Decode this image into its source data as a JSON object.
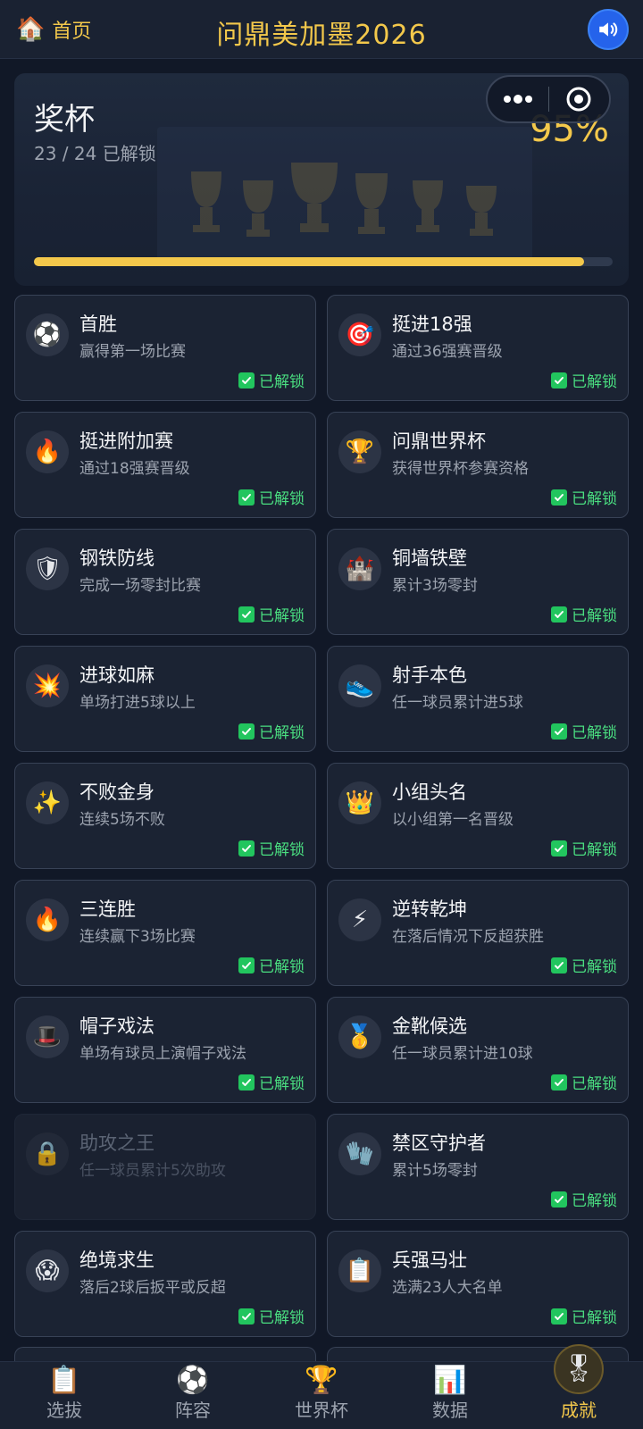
{
  "header": {
    "home_icon": "house-icon",
    "home_label": "首页",
    "title": "问鼎美加墨2026",
    "sound_icon": "speaker-icon"
  },
  "hero": {
    "title": "奖杯",
    "progress_text": "23 / 24 已解锁",
    "percent_text": "95%",
    "progress_fraction": 0.95,
    "capsule": {
      "more_icon": "more-dots-icon",
      "close_icon": "target-icon"
    }
  },
  "colors": {
    "accent": "#f3c84b",
    "unlocked": "#4ade80",
    "background": "#111827",
    "card": "#1b2333"
  },
  "achievements": [
    {
      "icon": "⚽",
      "icon_name": "soccer-ball-icon",
      "title": "首胜",
      "desc": "赢得第一场比赛",
      "status": "已解锁",
      "locked": false
    },
    {
      "icon": "🎯",
      "icon_name": "target-icon",
      "title": "挺进18强",
      "desc": "通过36强赛晋级",
      "status": "已解锁",
      "locked": false
    },
    {
      "icon": "🔥",
      "icon_name": "fire-icon",
      "title": "挺进附加赛",
      "desc": "通过18强赛晋级",
      "status": "已解锁",
      "locked": false
    },
    {
      "icon": "🏆",
      "icon_name": "trophy-icon",
      "title": "问鼎世界杯",
      "desc": "获得世界杯参赛资格",
      "status": "已解锁",
      "locked": false
    },
    {
      "icon": "🛡",
      "icon_name": "shield-icon",
      "title": "钢铁防线",
      "desc": "完成一场零封比赛",
      "status": "已解锁",
      "locked": false
    },
    {
      "icon": "🏰",
      "icon_name": "castle-icon",
      "title": "铜墙铁壁",
      "desc": "累计3场零封",
      "status": "已解锁",
      "locked": false
    },
    {
      "icon": "💥",
      "icon_name": "explosion-icon",
      "title": "进球如麻",
      "desc": "单场打进5球以上",
      "status": "已解锁",
      "locked": false
    },
    {
      "icon": "👟",
      "icon_name": "sneaker-icon",
      "title": "射手本色",
      "desc": "任一球员累计进5球",
      "status": "已解锁",
      "locked": false
    },
    {
      "icon": "✨",
      "icon_name": "sparkles-icon",
      "title": "不败金身",
      "desc": "连续5场不败",
      "status": "已解锁",
      "locked": false
    },
    {
      "icon": "👑",
      "icon_name": "crown-icon",
      "title": "小组头名",
      "desc": "以小组第一名晋级",
      "status": "已解锁",
      "locked": false
    },
    {
      "icon": "🔥",
      "icon_name": "fire-icon",
      "title": "三连胜",
      "desc": "连续赢下3场比赛",
      "status": "已解锁",
      "locked": false
    },
    {
      "icon": "⚡",
      "icon_name": "lightning-icon",
      "title": "逆转乾坤",
      "desc": "在落后情况下反超获胜",
      "status": "已解锁",
      "locked": false
    },
    {
      "icon": "🎩",
      "icon_name": "top-hat-icon",
      "title": "帽子戏法",
      "desc": "单场有球员上演帽子戏法",
      "status": "已解锁",
      "locked": false
    },
    {
      "icon": "🥇",
      "icon_name": "medal-icon",
      "title": "金靴候选",
      "desc": "任一球员累计进10球",
      "status": "已解锁",
      "locked": false
    },
    {
      "icon": "🔒",
      "icon_name": "lock-icon",
      "title": "助攻之王",
      "desc": "任一球员累计5次助攻",
      "status": "",
      "locked": true
    },
    {
      "icon": "🧤",
      "icon_name": "gloves-icon",
      "title": "禁区守护者",
      "desc": "累计5场零封",
      "status": "已解锁",
      "locked": false
    },
    {
      "icon": "😱",
      "icon_name": "scream-face-icon",
      "title": "绝境求生",
      "desc": "落后2球后扳平或反超",
      "status": "已解锁",
      "locked": false
    },
    {
      "icon": "📋",
      "icon_name": "clipboard-icon",
      "title": "兵强马壮",
      "desc": "选满23人大名单",
      "status": "已解锁",
      "locked": false
    }
  ],
  "nav": [
    {
      "icon": "📋",
      "icon_name": "clipboard-icon",
      "label": "选拔",
      "active": false
    },
    {
      "icon": "⚽",
      "icon_name": "soccer-ball-icon",
      "label": "阵容",
      "active": false
    },
    {
      "icon": "🏆",
      "icon_name": "trophy-icon",
      "label": "世界杯",
      "active": false
    },
    {
      "icon": "📊",
      "icon_name": "bar-chart-icon",
      "label": "数据",
      "active": false
    },
    {
      "icon": "🎖",
      "icon_name": "medal-icon",
      "label": "成就",
      "active": true
    }
  ]
}
